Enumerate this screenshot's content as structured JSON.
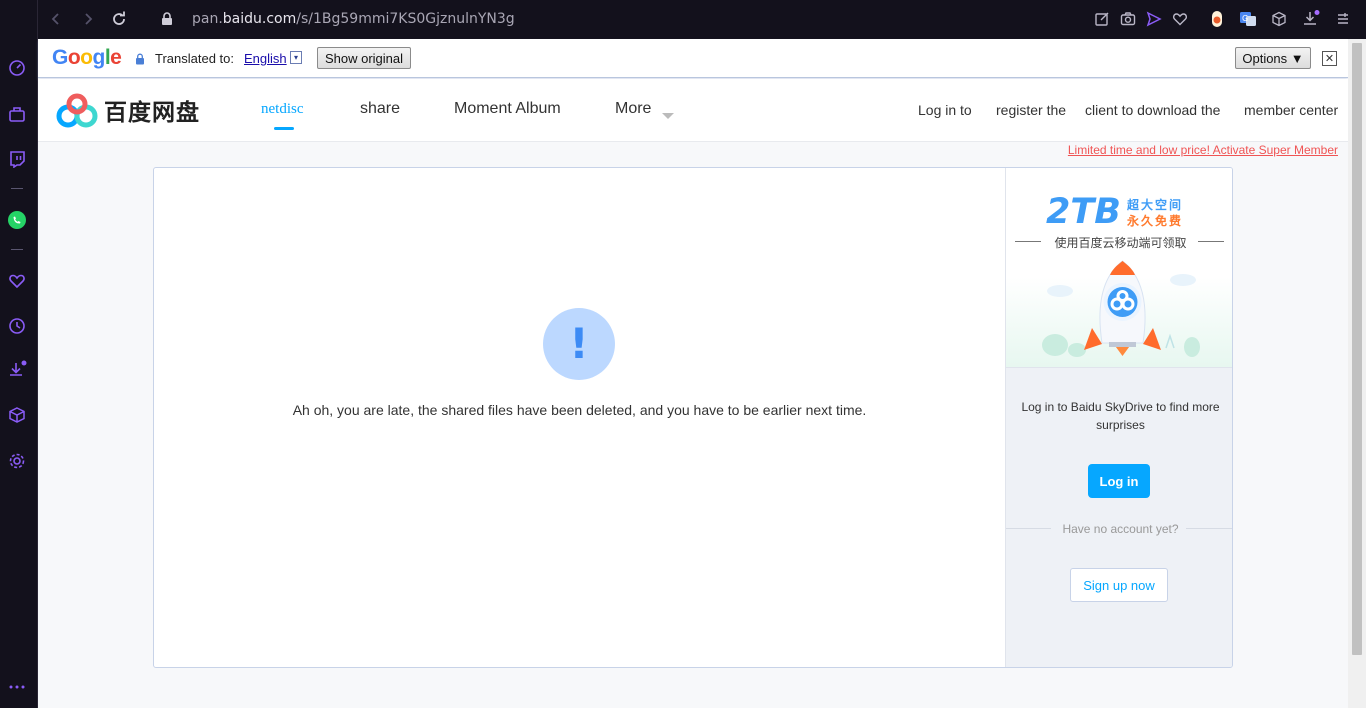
{
  "browser": {
    "url_prefix": "pan.",
    "url_domain": "baidu.com",
    "url_path": "/s/1Bg59mmi7KS0GjznulnYN3g"
  },
  "translate_bar": {
    "google_label": "Google",
    "translated_to_label": "Translated to:",
    "language": "English",
    "lang_dropdown_glyph": "▾",
    "show_original_label": "Show original",
    "options_label": "Options ▼",
    "close_glyph": "✕"
  },
  "header": {
    "logo_text": "百度网盘",
    "nav": [
      {
        "label": "netdisc",
        "active": true
      },
      {
        "label": "share"
      },
      {
        "label": "Moment Album"
      },
      {
        "label": "More"
      }
    ],
    "right_links": [
      "Log in to",
      "register the",
      "client to download the",
      "member center"
    ]
  },
  "promo_link": "Limited time and low price! Activate Super Member",
  "main": {
    "warning_symbol": "!",
    "message": "Ah oh, you are late, the shared files have been deleted, and you have to be earlier next time."
  },
  "side_panel": {
    "ad": {
      "big_text": "2TB",
      "line1": "超大空间",
      "line2": "永久免费",
      "subtitle": "使用百度云移动端可领取"
    },
    "login_prompt": "Log in to Baidu SkyDrive to find more surprises",
    "login_button": "Log in",
    "no_account_text": "Have no account yet?",
    "signup_button": "Sign up now"
  },
  "colors": {
    "accent": "#06a7ff",
    "promo": "#f05454",
    "sidebar_bg": "#13111c",
    "sidebar_icon": "#8a5cf6"
  }
}
